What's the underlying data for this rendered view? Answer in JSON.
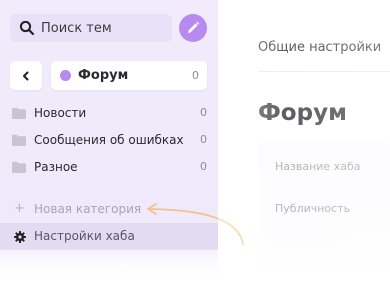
{
  "search": {
    "placeholder": "Поиск тем"
  },
  "forum": {
    "name": "Форум",
    "count": "0"
  },
  "categories": [
    {
      "label": "Новости",
      "count": "0"
    },
    {
      "label": "Сообщения об ошибках",
      "count": "0"
    },
    {
      "label": "Разное",
      "count": "0"
    }
  ],
  "add_category": {
    "label": "Новая категория"
  },
  "hub_settings": {
    "label": "Настройки хаба"
  },
  "main": {
    "tab_general": "Общие настройки",
    "title": "Форум",
    "fields": [
      "Название хаба",
      "Публичность"
    ]
  },
  "colors": {
    "accent": "#b78aef",
    "sidebar": "#f1ebfb",
    "arrow": "#f0c48a"
  }
}
